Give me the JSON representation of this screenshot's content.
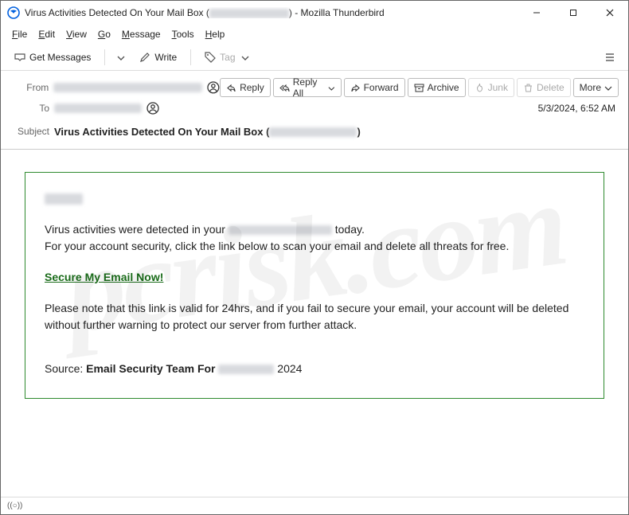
{
  "window": {
    "title_prefix": "Virus Activities Detected On Your Mail Box (",
    "title_suffix": ") - Mozilla Thunderbird"
  },
  "menu": {
    "file": "File",
    "edit": "Edit",
    "view": "View",
    "go": "Go",
    "message": "Message",
    "tools": "Tools",
    "help": "Help"
  },
  "toolbar": {
    "get_messages": "Get Messages",
    "write": "Write",
    "tag": "Tag"
  },
  "header": {
    "from_label": "From",
    "to_label": "To",
    "subject_label": "Subject",
    "subject_prefix": "Virus Activities Detected On Your Mail Box (",
    "subject_suffix": ")",
    "timestamp": "5/3/2024, 6:52 AM"
  },
  "actions": {
    "reply": "Reply",
    "reply_all": "Reply All",
    "forward": "Forward",
    "archive": "Archive",
    "junk": "Junk",
    "delete": "Delete",
    "more": "More"
  },
  "body": {
    "p1a": "Virus activities were detected in your ",
    "p1b": " today.",
    "p2": "For your account security, click the link below to scan your email and delete all threats for free.",
    "link": "Secure My Email Now!",
    "p3": "Please note that this link is valid for 24hrs, and if you fail to secure your email, your account will be deleted without further warning to protect our server from further attack.",
    "source_label": "Source: ",
    "source_team_prefix": "Email Security Team For  ",
    "source_year": " 2024"
  },
  "status": {
    "connection": "((○))"
  },
  "watermark": "pcrisk.com"
}
